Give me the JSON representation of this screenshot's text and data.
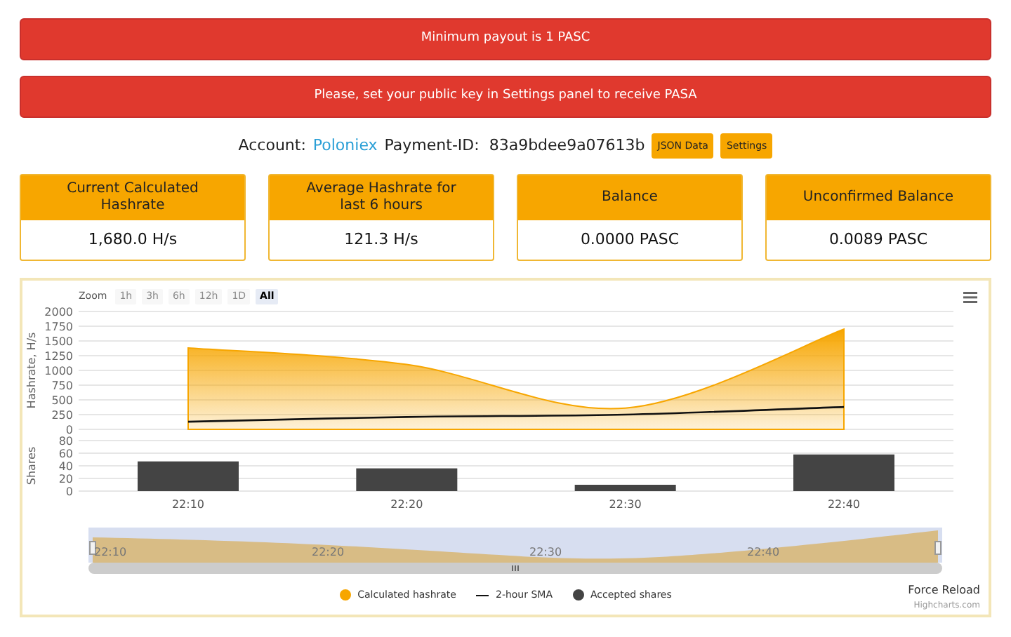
{
  "alerts": [
    {
      "text": "Minimum payout is 1 PASC"
    },
    {
      "text": "Please, set your public key in Settings panel to receive PASA"
    }
  ],
  "account": {
    "label": "Account:",
    "name": "Poloniex",
    "payment_label": "Payment-ID:",
    "payment_id": "83a9bdee9a07613b",
    "buttons": [
      "JSON Data",
      "Settings"
    ]
  },
  "cards": [
    {
      "title": "Current Calculated Hashrate",
      "value": "1,680.0 H/s"
    },
    {
      "title": "Average Hashrate for last 6 hours",
      "value": "121.3 H/s"
    },
    {
      "title": "Balance",
      "value": "0.0000 PASC"
    },
    {
      "title": "Unconfirmed Balance",
      "value": "0.0089 PASC"
    }
  ],
  "chart": {
    "zoom_label": "Zoom",
    "zoom_buttons": [
      {
        "label": "1h",
        "selected": false,
        "disabled": true
      },
      {
        "label": "3h",
        "selected": false,
        "disabled": true
      },
      {
        "label": "6h",
        "selected": false,
        "disabled": true
      },
      {
        "label": "12h",
        "selected": false,
        "disabled": true
      },
      {
        "label": "1D",
        "selected": false,
        "disabled": true
      },
      {
        "label": "All",
        "selected": true,
        "disabled": false
      }
    ],
    "hashrate_panel": {
      "chart_data": {
        "type": "area",
        "ylabel": "Hashrate, H/s",
        "grid": true,
        "ylim": [
          0,
          2000
        ],
        "yticks": [
          0,
          250,
          500,
          750,
          1000,
          1250,
          1500,
          1750,
          2000
        ],
        "series": [
          {
            "name": "Calculated hashrate",
            "color": "#f7a600",
            "values": [
              1380,
              1100,
              360,
              1700
            ]
          },
          {
            "name": "2-hour SMA",
            "color": "#111111",
            "type": "line",
            "values": [
              130,
              210,
              250,
              380
            ]
          }
        ]
      }
    },
    "shares_panel": {
      "chart_data": {
        "type": "bar",
        "ylabel": "Shares",
        "grid": true,
        "categories": [
          "22:10",
          "22:20",
          "22:30",
          "22:40"
        ],
        "ylim": [
          0,
          80
        ],
        "yticks": [
          0,
          20,
          40,
          60,
          80
        ],
        "series": [
          {
            "name": "Accepted shares",
            "color": "#444444",
            "values": [
              47,
              36,
              10,
              58
            ]
          }
        ]
      }
    },
    "navigator_labels": [
      "22:10",
      "22:20",
      "22:30",
      "22:40"
    ],
    "force_reload": "Force Reload",
    "credits": "Highcharts.com"
  }
}
